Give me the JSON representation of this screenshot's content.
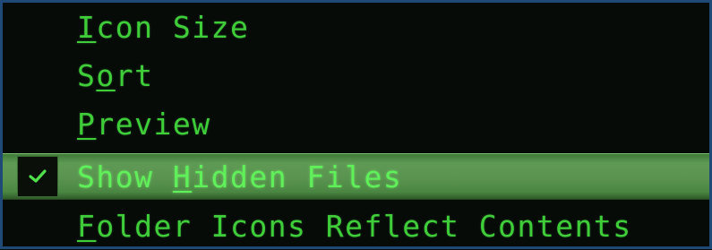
{
  "menu": {
    "items": [
      {
        "pre": "",
        "accel": "I",
        "post": "con Size",
        "checked": false
      },
      {
        "pre": "S",
        "accel": "o",
        "post": "rt",
        "checked": false
      },
      {
        "pre": "",
        "accel": "P",
        "post": "review",
        "checked": false
      },
      {
        "pre": "Show ",
        "accel": "H",
        "post": "idden Files",
        "checked": true
      },
      {
        "pre": "",
        "accel": "F",
        "post": "older Icons Reflect Contents",
        "checked": false
      }
    ],
    "check_icon": "checkmark-icon"
  },
  "colors": {
    "text": "#3fcd3a",
    "highlight": "#5a9350",
    "border": "#1f4a78",
    "background": "#070b08"
  }
}
